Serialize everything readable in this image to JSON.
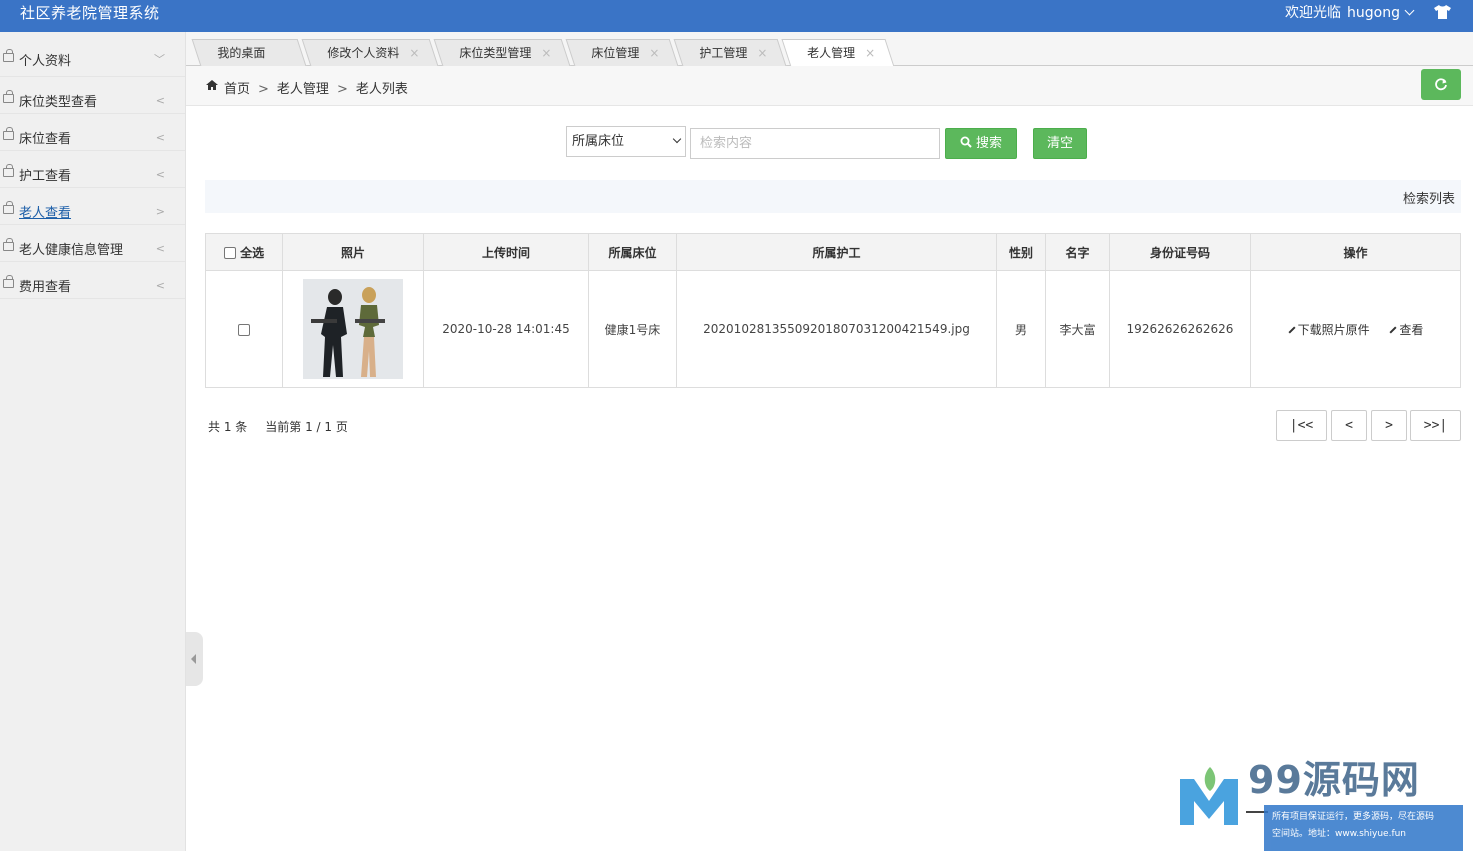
{
  "app": {
    "title": "社区养老院管理系统",
    "welcome": "欢迎光临",
    "username": "hugong"
  },
  "sidebar": {
    "items": [
      {
        "label": "个人资料",
        "arrow": "﹀"
      },
      {
        "label": "床位类型查看",
        "arrow": "<"
      },
      {
        "label": "床位查看",
        "arrow": "<"
      },
      {
        "label": "护工查看",
        "arrow": "<"
      },
      {
        "label": "老人查看",
        "arrow": ">"
      },
      {
        "label": "老人健康信息管理",
        "arrow": "<"
      },
      {
        "label": "费用查看",
        "arrow": "<"
      }
    ]
  },
  "tabs": [
    {
      "label": "我的桌面",
      "close": ""
    },
    {
      "label": "修改个人资料",
      "close": "×"
    },
    {
      "label": "床位类型管理",
      "close": "×"
    },
    {
      "label": "床位管理",
      "close": "×"
    },
    {
      "label": "护工管理",
      "close": "×"
    },
    {
      "label": "老人管理",
      "close": "×"
    }
  ],
  "breadcrumb": {
    "home": "首页",
    "level1": "老人管理",
    "level2": "老人列表",
    "sep": ">"
  },
  "search": {
    "select_value": "所属床位",
    "input_placeholder": "检索内容",
    "search_label": "搜索",
    "clear_label": "清空"
  },
  "result_title": "检索列表",
  "table": {
    "headers": {
      "select_all": "全选",
      "photo": "照片",
      "upload_time": "上传时间",
      "bed": "所属床位",
      "nurse": "所属护工",
      "gender": "性别",
      "name": "名字",
      "id_number": "身份证号码",
      "actions": "操作"
    },
    "rows": [
      {
        "upload_time": "2020-10-28 14:01:45",
        "bed": "健康1号床",
        "nurse": "20201028135509201807031200421549.jpg",
        "gender": "男",
        "name": "李大富",
        "id_number": "19262626262626",
        "download_label": "下载照片原件",
        "view_label": "查看"
      }
    ]
  },
  "pagination": {
    "total": "共 1 条",
    "current": "当前第 1 / 1 页",
    "first": "|<<",
    "prev": "<",
    "next": ">",
    "last": ">>|"
  },
  "watermark": {
    "brand": "99源码网",
    "line1": "所有项目保证运行，更多源码，尽在源码",
    "line2": "空间站。地址：www.shiyue.fun"
  },
  "colors": {
    "header_bg": "#3a74c6",
    "accent_green": "#5cb85c",
    "sidebar_bg": "#f0f0f0",
    "active_link": "#1c5ea8"
  }
}
